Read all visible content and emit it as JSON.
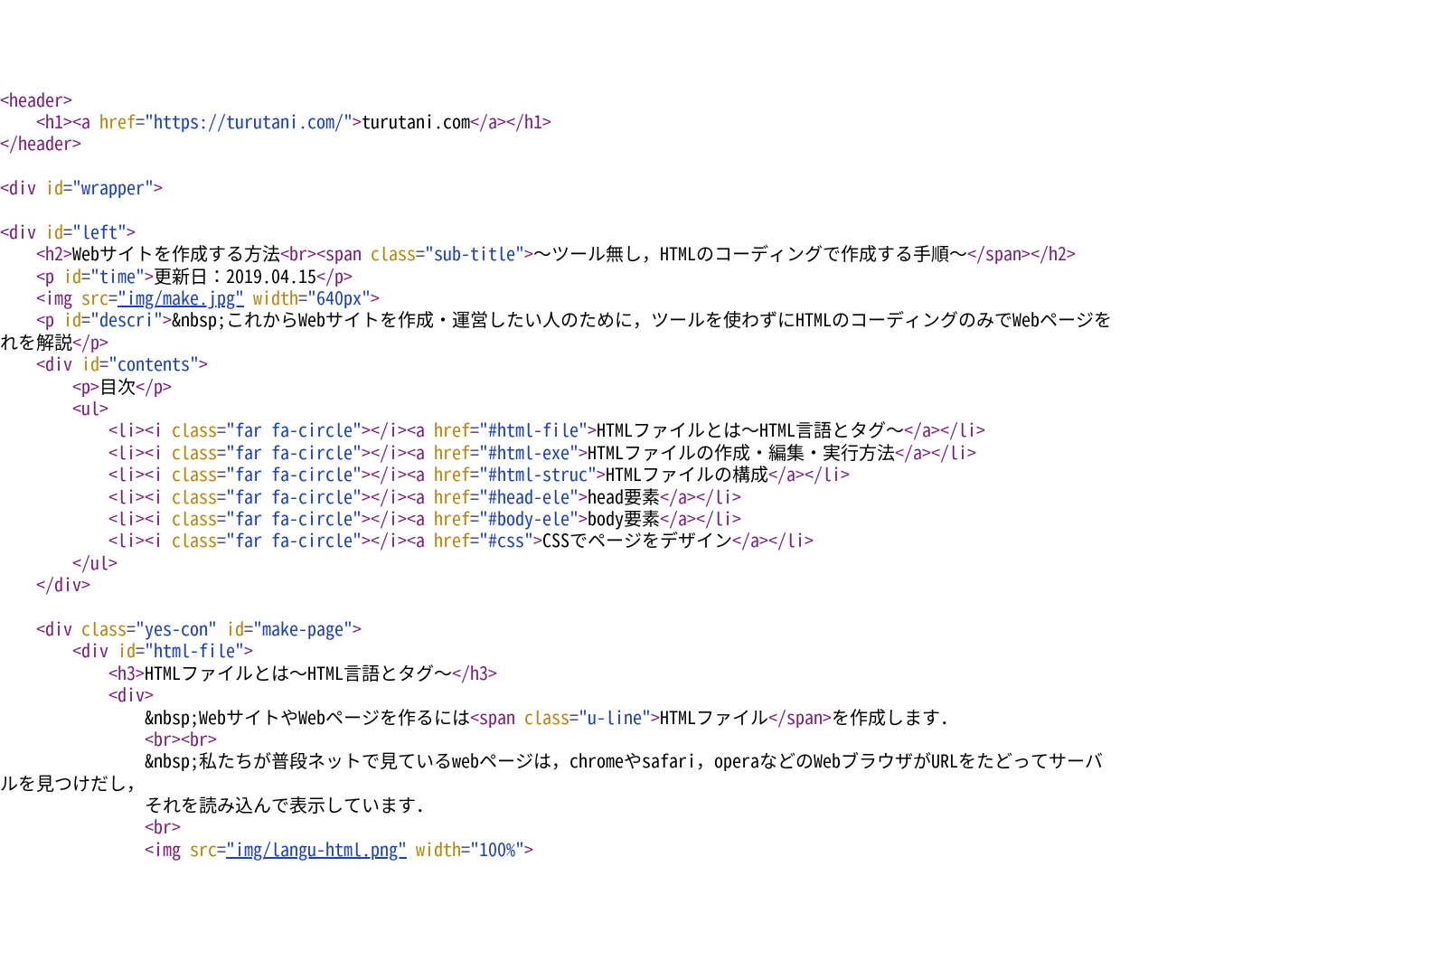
{
  "header_tag_open": "<header>",
  "h1_open": "    <h1><a ",
  "h1_href_attr": "href",
  "h1_href_val": "\"https://turutani.com/\"",
  "h1_close1": ">",
  "h1_text": "turutani.com",
  "h1_rest": "</a></h1>",
  "header_tag_close": "</header>",
  "div_wrapper": "<div ",
  "id_attr": "id",
  "wrapper_id": "\"wrapper\"",
  "close_angle": ">",
  "div_left": "<div ",
  "left_id": "\"left\"",
  "h2_open": "    <h2>",
  "h2_text1": "Webサイトを作成する方法",
  "h2_br": "<br><span ",
  "class_attr": "class",
  "subtitle_class": "\"sub-title\"",
  "h2_text2": "～ツール無し，HTMLのコーディングで作成する手順～",
  "h2_close": "</span></h2>",
  "p_time_open": "    <p ",
  "time_id": "\"time\"",
  "time_text": "更新日：2019.04.15",
  "p_close": "</p>",
  "img1_open": "    <img ",
  "src_attr": "src",
  "img1_src": "\"img/make.jpg\"",
  "width_attr": "width",
  "img1_width": "\"640px\"",
  "p_descri_open": "    <p ",
  "descri_id": "\"descri\"",
  "nbsp": "&nbsp;",
  "descri_text1": "これからWebサイトを作成・運営したい人のために，ツールを使わずにHTMLのコーディングのみでWebページを",
  "descri_text2": "れを解説",
  "div_contents_open": "    <div ",
  "contents_id": "\"contents\"",
  "mokuji_open": "        <p>",
  "mokuji_text": "目次",
  "ul_open": "        <ul>",
  "li_open": "            <li><i ",
  "far_class": "\"far fa-circle\"",
  "i_close_a": "></i><a ",
  "href_attr": "href",
  "li1_href": "\"#html-file\"",
  "li1_text": "HTMLファイルとは～HTML言語とタグ～",
  "li2_href": "\"#html-exe\"",
  "li2_text": "HTMLファイルの作成・編集・実行方法",
  "li3_href": "\"#html-struc\"",
  "li3_text": "HTMLファイルの構成",
  "li4_href": "\"#head-ele\"",
  "li4_text": "head要素",
  "li5_href": "\"#body-ele\"",
  "li5_text": "body要素",
  "li6_href": "\"#css\"",
  "li6_text": "CSSでページをデザイン",
  "li_close": "</a></li>",
  "ul_close": "        </ul>",
  "div_close": "    </div>",
  "div_yescon_open": "    <div ",
  "yescon_class": "\"yes-con\"",
  "makepage_id": "\"make-page\"",
  "div_htmlfile_open": "        <div ",
  "htmlfile_id": "\"html-file\"",
  "h3_open": "            <h3>",
  "h3_text": "HTMLファイルとは～HTML言語とタグ～",
  "h3_close": "</h3>",
  "inner_div_open": "            <div>",
  "body_line1a": "WebサイトやWebページを作るには",
  "span_open": "<span ",
  "uline_class": "\"u-line\"",
  "span_text": "HTMLファイル",
  "span_close": "</span>",
  "body_line1b": "を作成します．",
  "brbr": "                <br><br>",
  "body_line2": "私たちが普段ネットで見ているwebページは，chromeやsafari，operaなどのWebブラウザがURLをたどってサーバ",
  "body_line2b": "ルを見つけだし，",
  "body_line3": "                それを読み込んで表示しています．",
  "single_br": "                <br>",
  "img2_open": "                <img ",
  "img2_src": "\"img/langu-html.png\"",
  "img2_width": "\"100%\"",
  "indent_nbsp": "                &nbsp;"
}
